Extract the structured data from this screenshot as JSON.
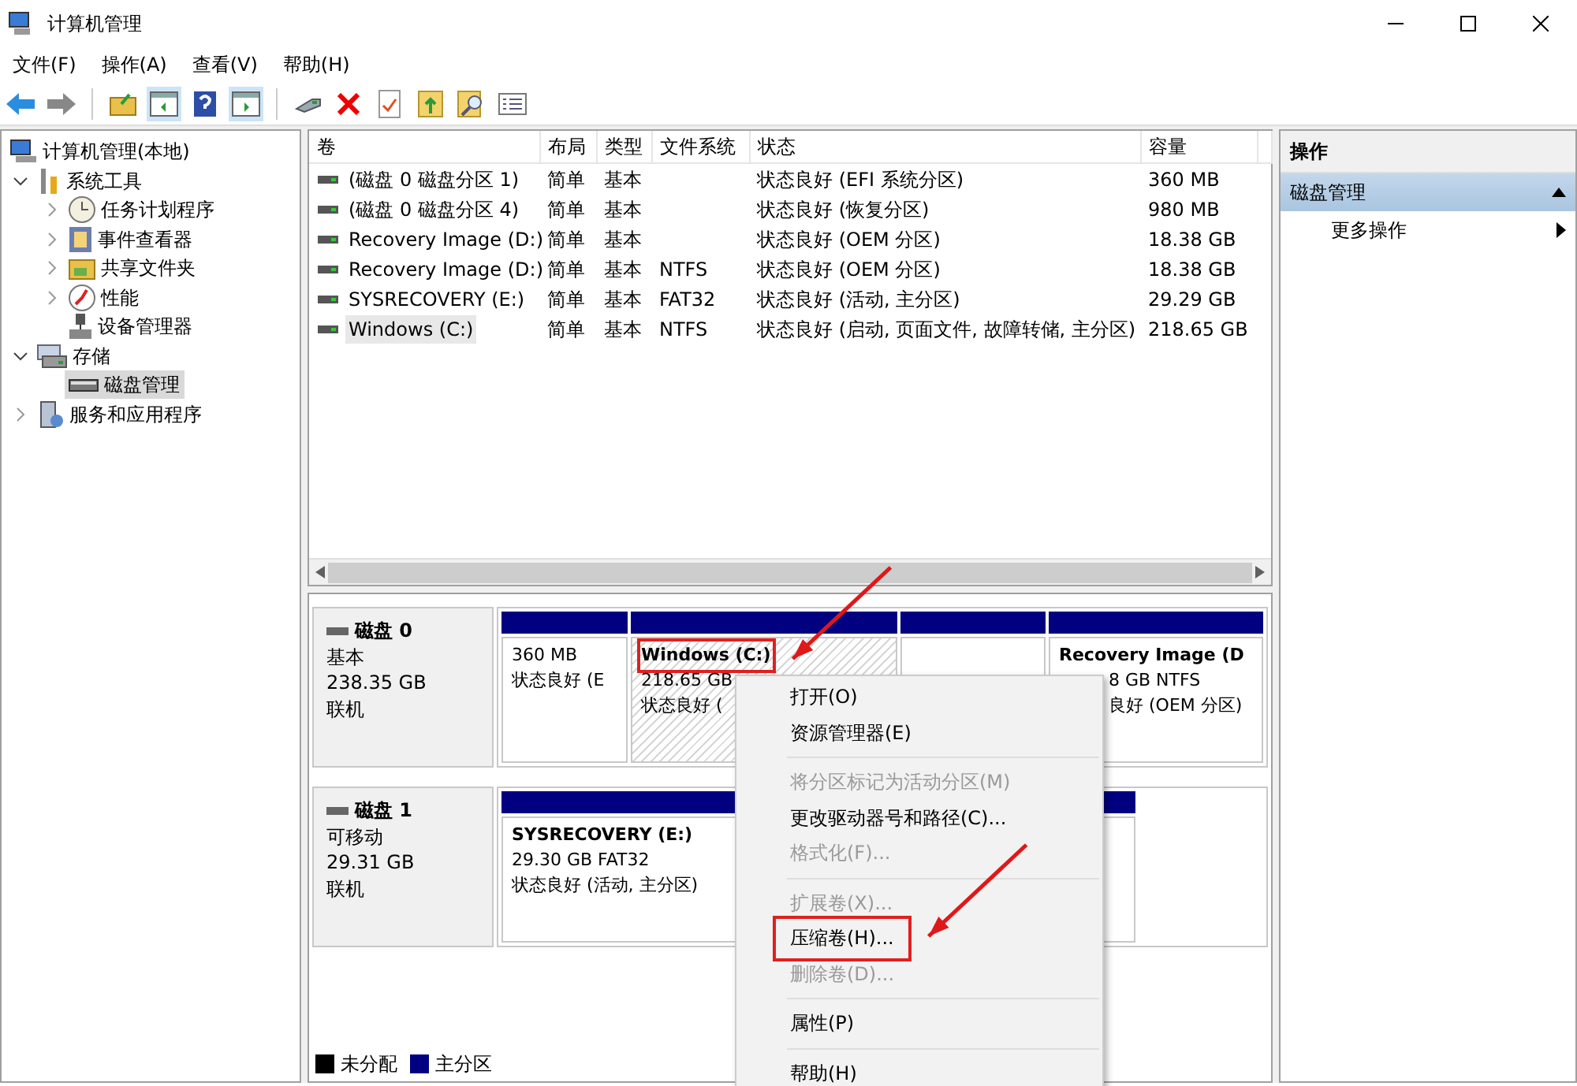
{
  "window": {
    "title": "计算机管理"
  },
  "menu_bar": [
    "文件(F)",
    "操作(A)",
    "查看(V)",
    "帮助(H)"
  ],
  "tree": [
    {
      "label": "计算机管理(本地)",
      "selected": false,
      "children": [
        {
          "label": "系统工具",
          "expanded": true,
          "selected": false,
          "children": [
            {
              "label": "任务计划程序",
              "expanded": false,
              "selected": false
            },
            {
              "label": "事件查看器",
              "expanded": false,
              "selected": false
            },
            {
              "label": "共享文件夹",
              "expanded": false,
              "selected": false
            },
            {
              "label": "性能",
              "expanded": false,
              "selected": false
            },
            {
              "label": "设备管理器",
              "selected": false
            }
          ]
        },
        {
          "label": "存储",
          "expanded": true,
          "selected": false,
          "children": [
            {
              "label": "磁盘管理",
              "selected": true
            }
          ]
        },
        {
          "label": "服务和应用程序",
          "expanded": false,
          "selected": false
        }
      ]
    }
  ],
  "volumes": {
    "columns": [
      "卷",
      "布局",
      "类型",
      "文件系统",
      "状态",
      "容量"
    ],
    "rows": [
      {
        "cells": [
          "(磁盘 0 磁盘分区 1)",
          "简单",
          "基本",
          "",
          "状态良好 (EFI 系统分区)",
          "360 MB"
        ],
        "selected": false
      },
      {
        "cells": [
          "(磁盘 0 磁盘分区 4)",
          "简单",
          "基本",
          "",
          "状态良好 (恢复分区)",
          "980 MB"
        ],
        "selected": false
      },
      {
        "cells": [
          "Recovery Image (D:)",
          "简单",
          "基本",
          "",
          "状态良好 (OEM 分区)",
          "18.38 GB"
        ],
        "selected": false
      },
      {
        "cells": [
          "Recovery Image (D:)",
          "简单",
          "基本",
          "NTFS",
          "状态良好 (OEM 分区)",
          "18.38 GB"
        ],
        "selected": false
      },
      {
        "cells": [
          "SYSRECOVERY (E:)",
          "简单",
          "基本",
          "FAT32",
          "状态良好 (活动, 主分区)",
          "29.29 GB"
        ],
        "selected": false
      },
      {
        "cells": [
          "Windows (C:)",
          "简单",
          "基本",
          "NTFS",
          "状态良好 (启动, 页面文件, 故障转储, 主分区)",
          "218.65 GB"
        ],
        "selected": true
      }
    ]
  },
  "disks": [
    {
      "name": "磁盘 0",
      "type": "基本",
      "size": "238.35 GB",
      "status": "联机",
      "partitions": [
        {
          "size": "360 MB",
          "status": "状态良好 (E",
          "selected": false
        },
        {
          "label": "Windows  (C:)",
          "size": "218.65 GB",
          "status": "状态良好 (",
          "selected": true,
          "highlighted": true
        },
        {
          "selected": false
        },
        {
          "label": "Recovery Image  (D",
          "size": "8 GB NTFS",
          "status": "良好 (OEM 分区)",
          "selected": false
        }
      ]
    },
    {
      "name": "磁盘 1",
      "type": "可移动",
      "size": "29.31 GB",
      "status": "联机",
      "partitions": [
        {
          "label": "SYSRECOVERY  (E:)",
          "size": "29.30 GB FAT32",
          "status": "状态良好 (活动, 主分区)",
          "selected": false
        }
      ]
    }
  ],
  "legend": [
    {
      "label": "未分配",
      "color": "#000000"
    },
    {
      "label": "主分区",
      "color": "#000080"
    }
  ],
  "actions": {
    "title": "操作",
    "sections": [
      {
        "label": "磁盘管理",
        "expanded": true,
        "items": [
          "更多操作"
        ]
      }
    ]
  },
  "context_menu": [
    {
      "kind": "item",
      "label": "打开(O)",
      "disabled": false
    },
    {
      "kind": "item",
      "label": "资源管理器(E)",
      "disabled": false
    },
    {
      "kind": "separator"
    },
    {
      "kind": "item",
      "label": "将分区标记为活动分区(M)",
      "disabled": true
    },
    {
      "kind": "item",
      "label": "更改驱动器号和路径(C)...",
      "disabled": false
    },
    {
      "kind": "item",
      "label": "格式化(F)...",
      "disabled": true
    },
    {
      "kind": "separator"
    },
    {
      "kind": "item",
      "label": "扩展卷(X)...",
      "disabled": true
    },
    {
      "kind": "item",
      "label": "压缩卷(H)...",
      "disabled": false,
      "highlighted": true
    },
    {
      "kind": "item",
      "label": "删除卷(D)...",
      "disabled": true
    },
    {
      "kind": "separator"
    },
    {
      "kind": "item",
      "label": "属性(P)",
      "disabled": false
    },
    {
      "kind": "separator"
    },
    {
      "kind": "item",
      "label": "帮助(H)",
      "disabled": false
    }
  ]
}
